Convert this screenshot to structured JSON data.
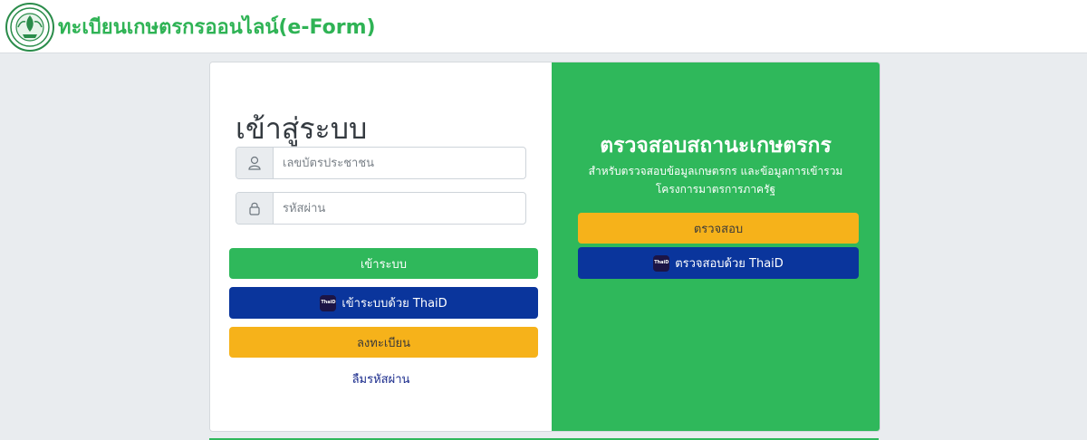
{
  "header": {
    "logo_icon": "ministry-seal-icon",
    "title": "ทะเบียนเกษตรกรออนไลน์(e-Form)"
  },
  "login": {
    "title": "เข้าสู่ระบบ",
    "id_field": {
      "icon": "user-icon",
      "placeholder": "เลขบัตรประชาชน",
      "value": ""
    },
    "password_field": {
      "icon": "lock-icon",
      "placeholder": "รหัสผ่าน",
      "value": ""
    },
    "login_button": "เข้าระบบ",
    "thaid_login_button": "เข้าระบบด้วย ThaiD",
    "register_button": "ลงทะเบียน",
    "forgot_password_link": "ลืมรหัสผ่าน"
  },
  "status_check": {
    "title": "ตรวจสอบสถานะเกษตรกร",
    "description": "สำหรับตรวจสอบข้อมูลเกษตรกร และข้อมูลการเข้ารวมโครงการมาตรการภาครัฐ",
    "check_button": "ตรวจสอบ",
    "thaid_check_button": "ตรวจสอบด้วย ThaiD"
  },
  "thaid_badge_text": "ThaiD",
  "colors": {
    "brand_green": "#2fb85b",
    "thaid_blue": "#0a359c",
    "warning_yellow": "#f6b21a",
    "title_green": "#2fb355"
  }
}
